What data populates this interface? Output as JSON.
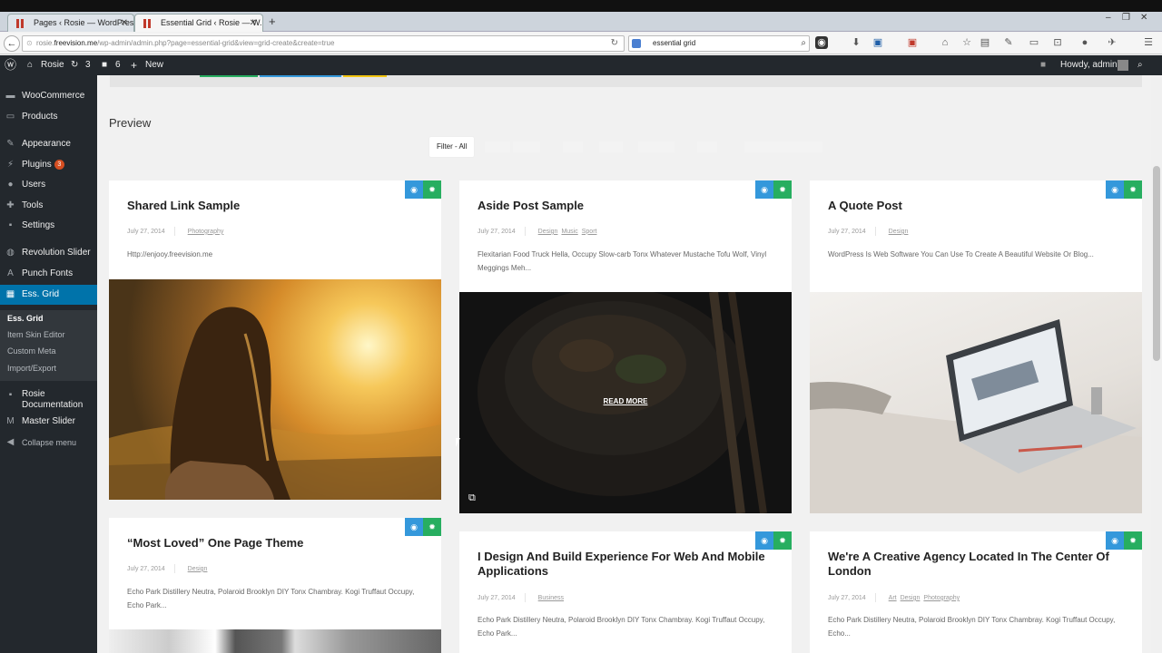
{
  "browser": {
    "tabs": [
      {
        "title": "Pages ‹ Rosie — WordPress"
      },
      {
        "title": "Essential Grid ‹ Rosie — W..."
      }
    ],
    "url_domain": "rosie.freevision.me",
    "url_path": "/wp-admin/admin.php?page=essential-grid&view=grid-create&create=true",
    "search_value": "essential grid"
  },
  "adminbar": {
    "site_name": "Rosie",
    "updates_count": "3",
    "comments_count": "6",
    "new_label": "New",
    "howdy": "Howdy, admin"
  },
  "sidebar": {
    "items": [
      {
        "label": "WooCommerce"
      },
      {
        "label": "Products"
      },
      {
        "label": "Appearance"
      },
      {
        "label": "Plugins",
        "badge": "3"
      },
      {
        "label": "Users"
      },
      {
        "label": "Tools"
      },
      {
        "label": "Settings"
      },
      {
        "label": "Revolution Slider"
      },
      {
        "label": "Punch Fonts"
      },
      {
        "label": "Ess. Grid"
      },
      {
        "label": "Rosie Documentation"
      },
      {
        "label": "Master Slider"
      },
      {
        "label": "Collapse menu"
      }
    ],
    "submenu": [
      "Ess. Grid",
      "Item Skin Editor",
      "Custom Meta",
      "Import/Export"
    ]
  },
  "main": {
    "preview_title": "Preview",
    "filter_label": "Filter - All",
    "cards": [
      {
        "title": "Shared Link Sample",
        "date": "July 27, 2014",
        "cats": [
          "Photography"
        ],
        "excerpt": "Http://enjooy.freevision.me"
      },
      {
        "title": "Aside Post Sample",
        "date": "July 27, 2014",
        "cats": [
          "Design",
          "Music",
          "Sport"
        ],
        "excerpt": "Flexitarian Food Truck Hella, Occupy Slow-carb Tonx Whatever Mustache Tofu Wolf, Vinyl Meggings Meh...",
        "overlay": "READ MORE"
      },
      {
        "title": "A Quote Post",
        "date": "July 27, 2014",
        "cats": [
          "Design"
        ],
        "excerpt": "WordPress Is Web Software You Can Use To Create A Beautiful Website Or Blog..."
      },
      {
        "title": "“Most Loved” One Page Theme",
        "date": "July 27, 2014",
        "cats": [
          "Design"
        ],
        "excerpt": "Echo Park Distillery Neutra, Polaroid Brooklyn DIY Tonx Chambray. Kogi Truffaut Occupy, Echo Park..."
      },
      {
        "title": "I Design And Build Experience For Web And Mobile Applications",
        "date": "July 27, 2014",
        "cats": [
          "Business"
        ],
        "excerpt": "Echo Park Distillery Neutra, Polaroid Brooklyn DIY Tonx Chambray. Kogi Truffaut Occupy, Echo Park..."
      },
      {
        "title": "We're A Creative Agency Located In The Center Of London",
        "date": "July 27, 2014",
        "cats": [
          "Art",
          "Design",
          "Photography"
        ],
        "excerpt": "Echo Park Distillery Neutra, Polaroid Brooklyn DIY Tonx Chambray. Kogi Truffaut Occupy, Echo..."
      }
    ]
  },
  "colors": {
    "eye": "#3498db",
    "gear": "#27ae60",
    "wp_blue": "#0073aa",
    "admin_dark": "#23282d"
  }
}
